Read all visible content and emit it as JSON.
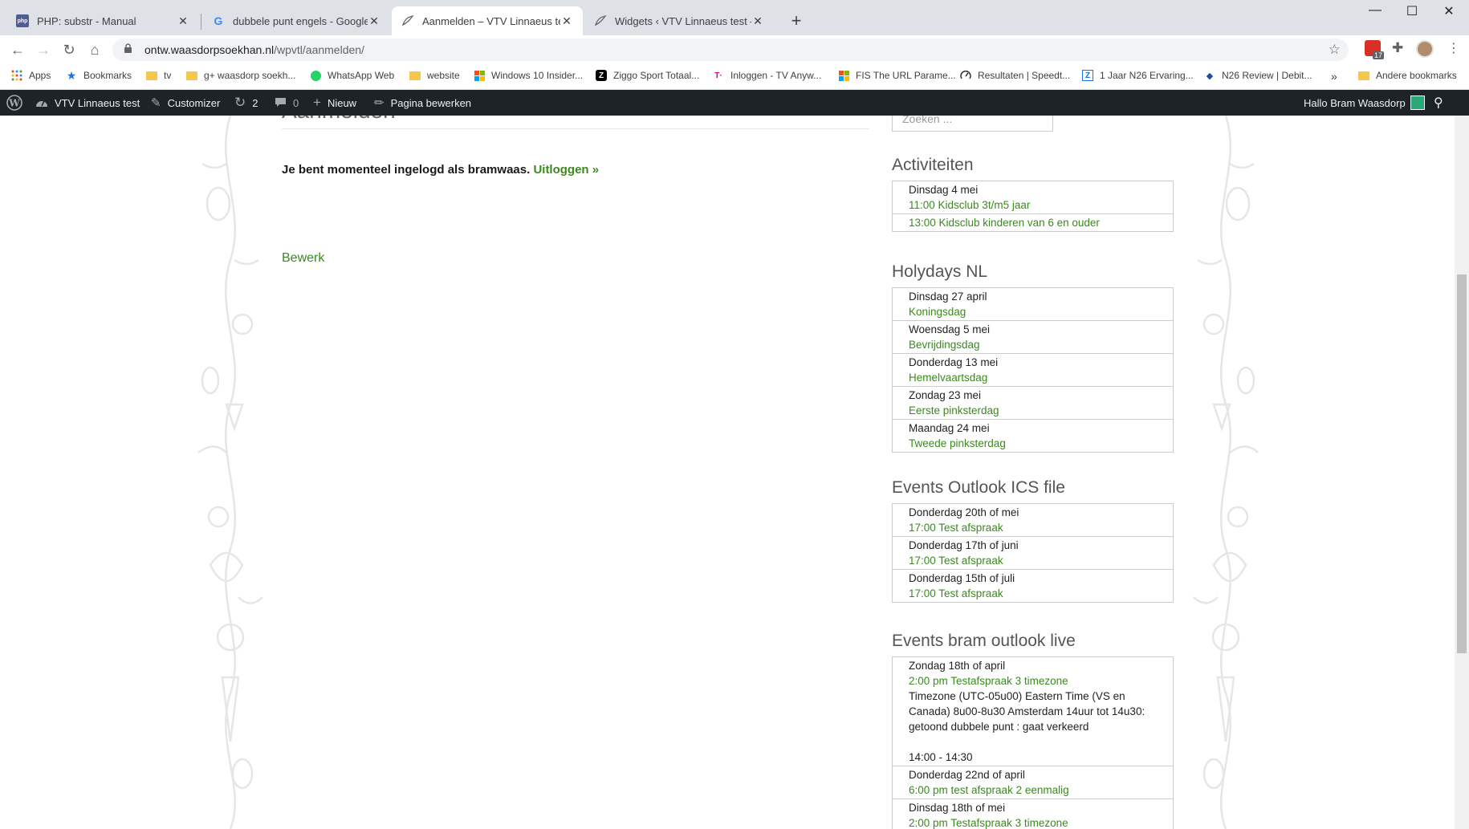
{
  "tabs": [
    {
      "title": "PHP: substr - Manual",
      "icon": "php-favicon-icon",
      "active": false
    },
    {
      "title": "dubbele punt engels - Google zo",
      "icon": "google-favicon-icon",
      "active": false
    },
    {
      "title": "Aanmelden – VTV Linnaeus test",
      "icon": "wp-site-favicon-icon",
      "active": true
    },
    {
      "title": "Widgets ‹ VTV Linnaeus test — V",
      "icon": "wp-site-favicon-icon",
      "active": false
    }
  ],
  "address_bar": {
    "host": "ontw.waasdorpsoekhan.nl",
    "path": "/wpvtl/aanmelden/"
  },
  "extension_badge": "17",
  "bookmarks": [
    {
      "label": "Apps",
      "icon": "apps-grid-icon"
    },
    {
      "label": "Bookmarks",
      "icon": "star-icon"
    },
    {
      "label": "tv",
      "icon": "folder-icon"
    },
    {
      "label": "g+ waasdorp soekh...",
      "icon": "folder-icon"
    },
    {
      "label": "WhatsApp Web",
      "icon": "whatsapp-icon"
    },
    {
      "label": "website",
      "icon": "folder-icon"
    },
    {
      "label": "Windows 10 Insider...",
      "icon": "windows-icon"
    },
    {
      "label": "Ziggo Sport Totaal...",
      "icon": "ziggo-icon"
    },
    {
      "label": "Inloggen - TV Anyw...",
      "icon": "tmobile-icon"
    },
    {
      "label": "FIS The URL Parame...",
      "icon": "windows-icon"
    },
    {
      "label": "Resultaten | Speedt...",
      "icon": "speedtest-icon"
    },
    {
      "label": "1 Jaar N26 Ervaring...",
      "icon": "z-icon"
    },
    {
      "label": "N26 Review | Debit...",
      "icon": "n26-icon"
    }
  ],
  "bookmarks_overflow": "»",
  "other_bookmarks": "Andere bookmarks",
  "admin_bar": {
    "site_name": "VTV Linnaeus test",
    "customizer": "Customizer",
    "updates_count": "2",
    "comments_count": "0",
    "new_label": "Nieuw",
    "edit_page": "Pagina bewerken",
    "greeting": "Hallo Bram Waasdorp"
  },
  "page": {
    "title": "Aanmelden",
    "login_message": "Je bent momenteel ingelogd als bramwaas.",
    "logout_link": "Uitloggen »",
    "edit_link": "Bewerk"
  },
  "sidebar": {
    "search_placeholder": "Zoeken ...",
    "widgets": [
      {
        "title": "Activiteiten",
        "items": [
          {
            "day": "Dinsdag 4 mei",
            "events": [
              "11:00 Kidsclub 3t/m5 jaar"
            ]
          },
          {
            "day": "",
            "events": [
              "13:00 Kidsclub kinderen van 6 en ouder"
            ]
          }
        ]
      },
      {
        "title": "Holydays NL",
        "items": [
          {
            "day": "Dinsdag 27 april",
            "events": [
              "Koningsdag"
            ]
          },
          {
            "day": "Woensdag 5 mei",
            "events": [
              "Bevrijdingsdag"
            ]
          },
          {
            "day": "Donderdag 13 mei",
            "events": [
              "Hemelvaartsdag"
            ]
          },
          {
            "day": "Zondag 23 mei",
            "events": [
              "Eerste pinksterdag"
            ]
          },
          {
            "day": "Maandag 24 mei",
            "events": [
              "Tweede pinksterdag"
            ]
          }
        ]
      },
      {
        "title": "Events Outlook ICS file",
        "items": [
          {
            "day": "Donderdag 20th of mei",
            "events": [
              "17:00 Test afspraak"
            ]
          },
          {
            "day": "Donderdag 17th of juni",
            "events": [
              "17:00 Test afspraak"
            ]
          },
          {
            "day": "Donderdag 15th of juli",
            "events": [
              "17:00 Test afspraak"
            ]
          }
        ]
      },
      {
        "title": "Events bram outlook live",
        "items": [
          {
            "day": "Zondag 18th of april",
            "events": [
              "2:00 pm Testafspraak 3 timezone"
            ],
            "description": "Timezone (UTC-05u00) Eastern Time (VS en Canada) 8u00-8u30 Amsterdam 14uur tot 14u30: getoond dubbele punt : gaat verkeerd\n\n14:00 - 14:30"
          },
          {
            "day": "Donderdag 22nd of april",
            "events": [
              "6:00 pm test afspraak 2 eenmalig"
            ]
          },
          {
            "day": "Dinsdag 18th of mei",
            "events": [
              "2:00 pm Testafspraak 3 timezone"
            ]
          }
        ]
      }
    ]
  },
  "colors": {
    "link_green": "#3a8a1e",
    "admin_bar": "#1d2327",
    "tab_strip": "#dee1e6"
  }
}
